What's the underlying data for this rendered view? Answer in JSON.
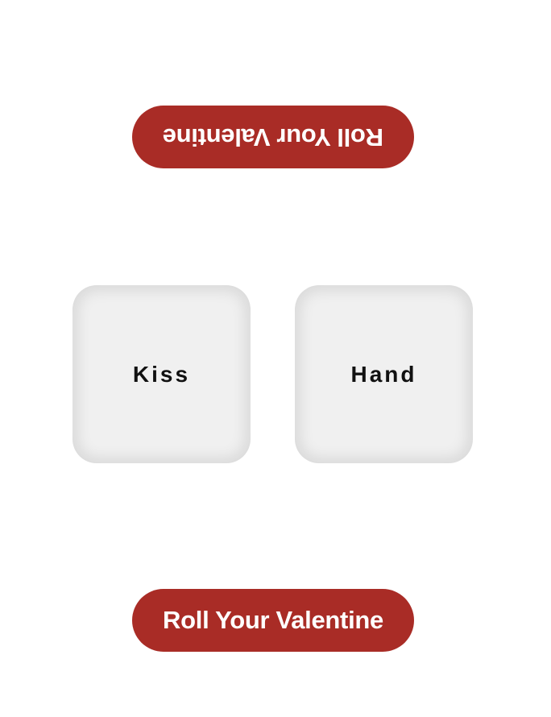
{
  "buttons": {
    "top_label": "Roll Your Valentine",
    "bottom_label": "Roll Your Valentine"
  },
  "dice": [
    {
      "label": "Kiss"
    },
    {
      "label": "Hand"
    }
  ],
  "colors": {
    "button_background": "#a92c26",
    "button_text": "#ffffff",
    "die_background": "#f0f0f0",
    "die_text": "#111111",
    "page_background": "#ffffff"
  }
}
